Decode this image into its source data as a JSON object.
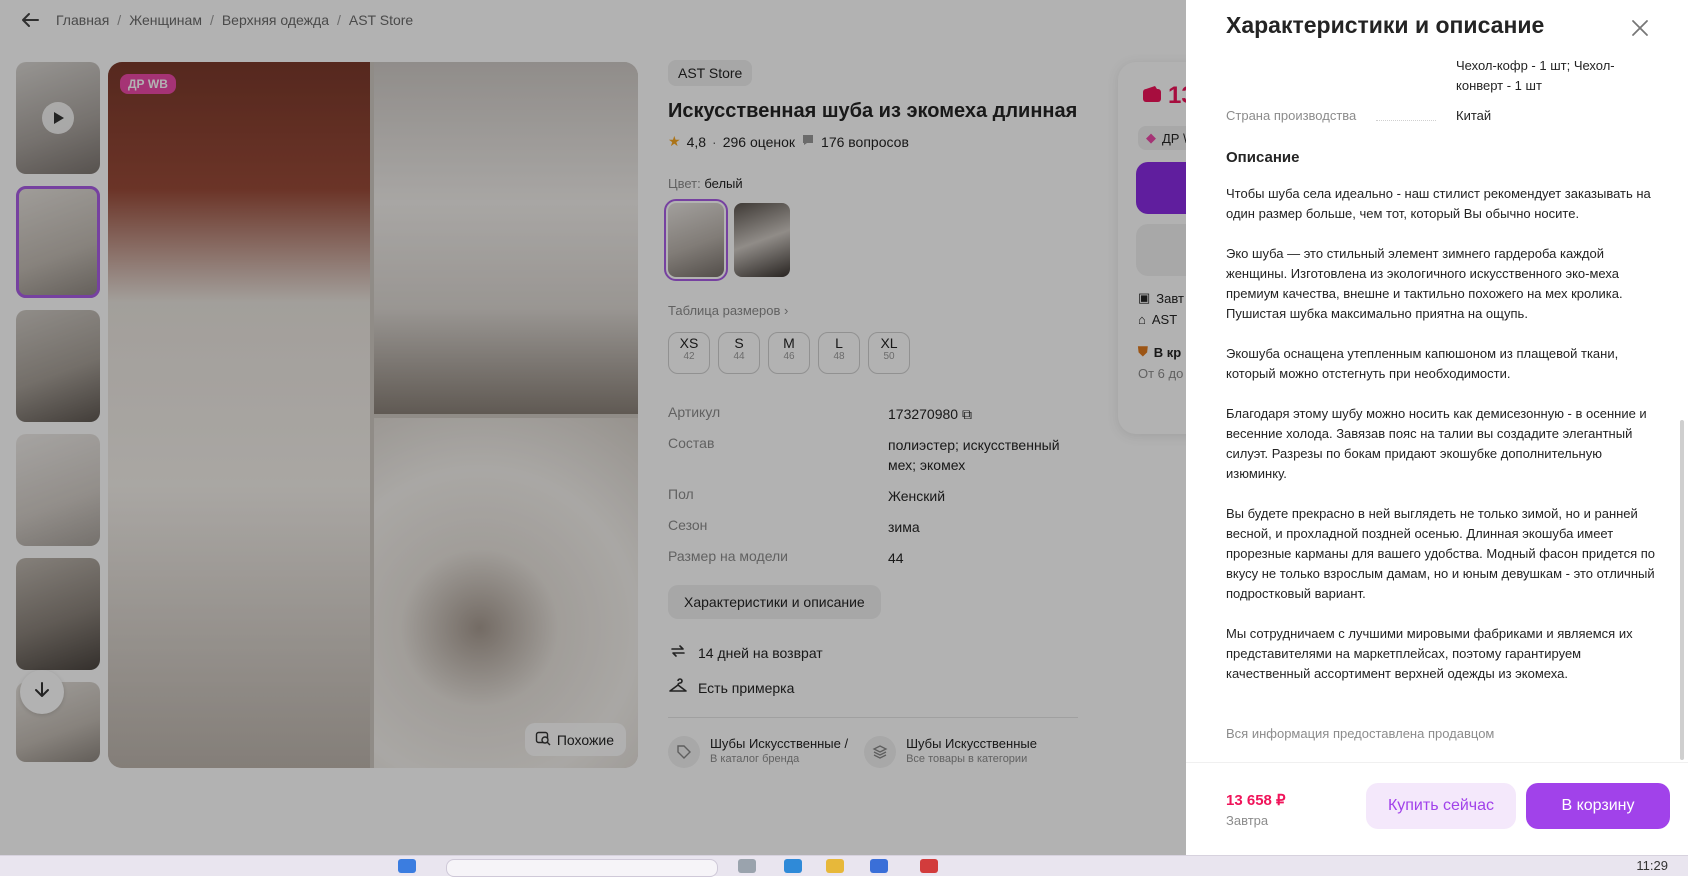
{
  "breadcrumb": [
    "Главная",
    "Женщинам",
    "Верхняя одежда",
    "AST Store"
  ],
  "gallery": {
    "badge": "ДР WB",
    "similar_label": "Похожие"
  },
  "product": {
    "store": "AST Store",
    "title": "Искусственная шуба из экомеха длинная",
    "rating": "4,8",
    "reviews": "296 оценок",
    "questions": "176 вопросов",
    "color_label": "Цвет:",
    "color_value": "белый",
    "size_table_label": "Таблица размеров",
    "sizes": [
      {
        "size": "XS",
        "ru": "42"
      },
      {
        "size": "S",
        "ru": "44"
      },
      {
        "size": "M",
        "ru": "46"
      },
      {
        "size": "L",
        "ru": "48"
      },
      {
        "size": "XL",
        "ru": "50"
      }
    ],
    "specs": [
      {
        "key": "Артикул",
        "value": "173270980"
      },
      {
        "key": "Состав",
        "value": "полиэстер; искусственный мех; экомех"
      },
      {
        "key": "Пол",
        "value": "Женский"
      },
      {
        "key": "Сезон",
        "value": "зима"
      },
      {
        "key": "Размер на модели",
        "value": "44"
      }
    ],
    "chars_button": "Характеристики и описание",
    "perks": [
      "14 дней на возврат",
      "Есть примерка"
    ],
    "categories": [
      {
        "title": "Шубы Искусственные /",
        "sub": "В каталог бренда"
      },
      {
        "title": "Шубы Искусственные",
        "sub": "Все товары в категории"
      }
    ]
  },
  "price_card": {
    "price_fragment": "13",
    "dr_fragment": "ДР \\",
    "delivery_fragment": "Завт",
    "store_fragment": "AST",
    "return_fragment": "В кр",
    "from_fragment": "От 6 до"
  },
  "panel": {
    "title": "Характеристики и описание",
    "package_value": "Чехол-кофр - 1 шт; Чехол-конверт - 1 шт",
    "country_key": "Страна производства",
    "country_value": "Китай",
    "description_heading": "Описание",
    "description": [
      "Чтобы шуба села идеально - наш стилист рекомендует заказывать на один размер больше, чем тот, который Вы обычно носите.",
      "Эко шуба — это стильный элемент зимнего гардероба каждой женщины. Изготовлена из экологичного искусственного эко-меха премиум качества, внешне и тактильно похожего на мех кролика. Пушистая шубка максимально приятна на ощупь.",
      "Экошуба оснащена утепленным капюшоном из плащевой ткани, который можно отстегнуть при необходимости.",
      "Благодаря этому шубу можно носить как демисезонную - в осенние и весенние холода. Завязав пояс на талии вы создадите элегантный силуэт. Разрезы по бокам придают экошубке дополнительную изюминку.",
      "Вы будете прекрасно в ней выглядеть не только зимой, но и ранней весной, и прохладной поздней осенью. Длинная экошуба имеет прорезные карманы для вашего удобства. Модный фасон придется по вкусу не только взрослым дамам, но и юным девушкам - это отличный подростковый вариант.",
      "Мы сотрудничаем с лучшими мировыми фабриками и являемся их представителями на маркетплейсах, поэтому гарантируем качественный ассортимент верхней одежды из экомеха."
    ],
    "seller_note": "Вся информация предоставлена продавцом",
    "footer_price": "13 658 ₽",
    "footer_delivery": "Завтра",
    "buy_now": "Купить сейчас",
    "to_cart": "В корзину"
  },
  "taskbar": {
    "clock": "11:29"
  },
  "colors": {
    "accent": "#a142ea",
    "price": "#f0145a",
    "badge": "#ec4aa8"
  }
}
